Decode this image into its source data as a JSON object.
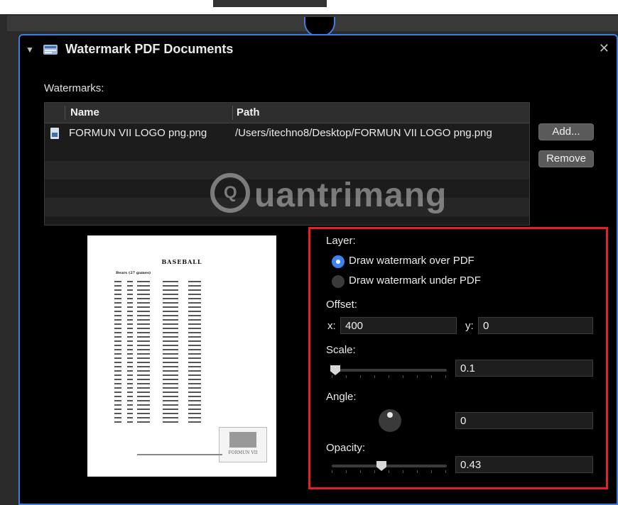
{
  "header": {
    "title": "Watermark PDF Documents"
  },
  "watermarks": {
    "label": "Watermarks:",
    "columns": [
      "Name",
      "Path"
    ],
    "rows": [
      {
        "name": "FORMUN VII LOGO png.png",
        "path": "/Users/itechno8/Desktop/FORMUN VII LOGO png.png"
      }
    ],
    "add_button": "Add...",
    "remove_button": "Remove"
  },
  "overlay_watermark": {
    "symbol": "Q",
    "text": "uantrimang"
  },
  "preview": {
    "title": "BASEBALL",
    "subtitle": "Bears (27 games)",
    "logo_text": "FORMUN VII"
  },
  "settings": {
    "layer_label": "Layer:",
    "layer_options": [
      "Draw watermark over PDF",
      "Draw watermark under PDF"
    ],
    "layer_selected_index": 0,
    "offset_label": "Offset:",
    "offset_x_label": "x:",
    "offset_x_value": "400",
    "offset_y_label": "y:",
    "offset_y_value": "0",
    "scale_label": "Scale:",
    "scale_value": "0.1",
    "angle_label": "Angle:",
    "angle_value": "0",
    "opacity_label": "Opacity:",
    "opacity_value": "0.43"
  },
  "colors": {
    "accent": "#3d7ddc",
    "highlight_border": "#e0202b",
    "radio_on": "#3d84f0"
  }
}
